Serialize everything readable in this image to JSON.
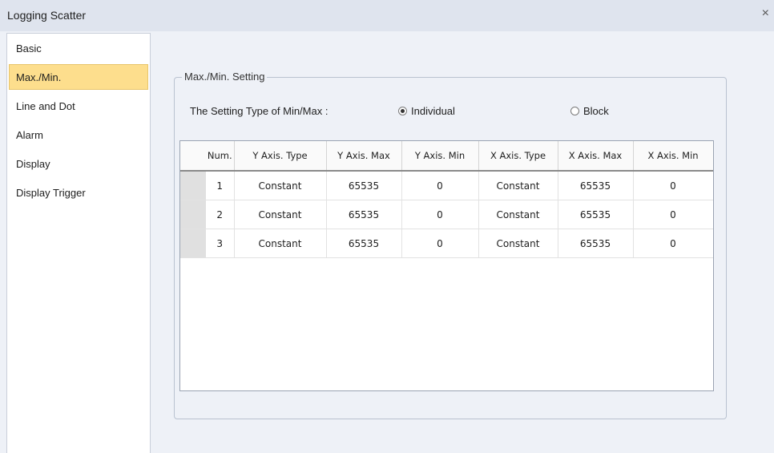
{
  "window": {
    "title": "Logging Scatter",
    "close_glyph": "×"
  },
  "nav": {
    "items": [
      {
        "label": "Basic"
      },
      {
        "label": "Max./Min."
      },
      {
        "label": "Line and Dot"
      },
      {
        "label": "Alarm"
      },
      {
        "label": "Display"
      },
      {
        "label": "Display Trigger"
      }
    ],
    "selected": "Max./Min."
  },
  "group": {
    "title": "Max./Min. Setting",
    "setting_label": "The Setting Type of Min/Max :",
    "options": [
      {
        "label": "Individual",
        "checked": true
      },
      {
        "label": "Block",
        "checked": false
      }
    ]
  },
  "table": {
    "columns": [
      "Num.",
      "Y Axis. Type",
      "Y Axis. Max",
      "Y Axis. Min",
      "X Axis. Type",
      "X Axis. Max",
      "X Axis. Min"
    ],
    "rows": [
      [
        "1",
        "Constant",
        "65535",
        "0",
        "Constant",
        "65535",
        "0"
      ],
      [
        "2",
        "Constant",
        "65535",
        "0",
        "Constant",
        "65535",
        "0"
      ],
      [
        "3",
        "Constant",
        "65535",
        "0",
        "Constant",
        "65535",
        "0"
      ]
    ]
  },
  "colors": {
    "selected_nav": "#fdde8d",
    "background": "#eef1f7",
    "titlebar": "#dfe4ee"
  }
}
